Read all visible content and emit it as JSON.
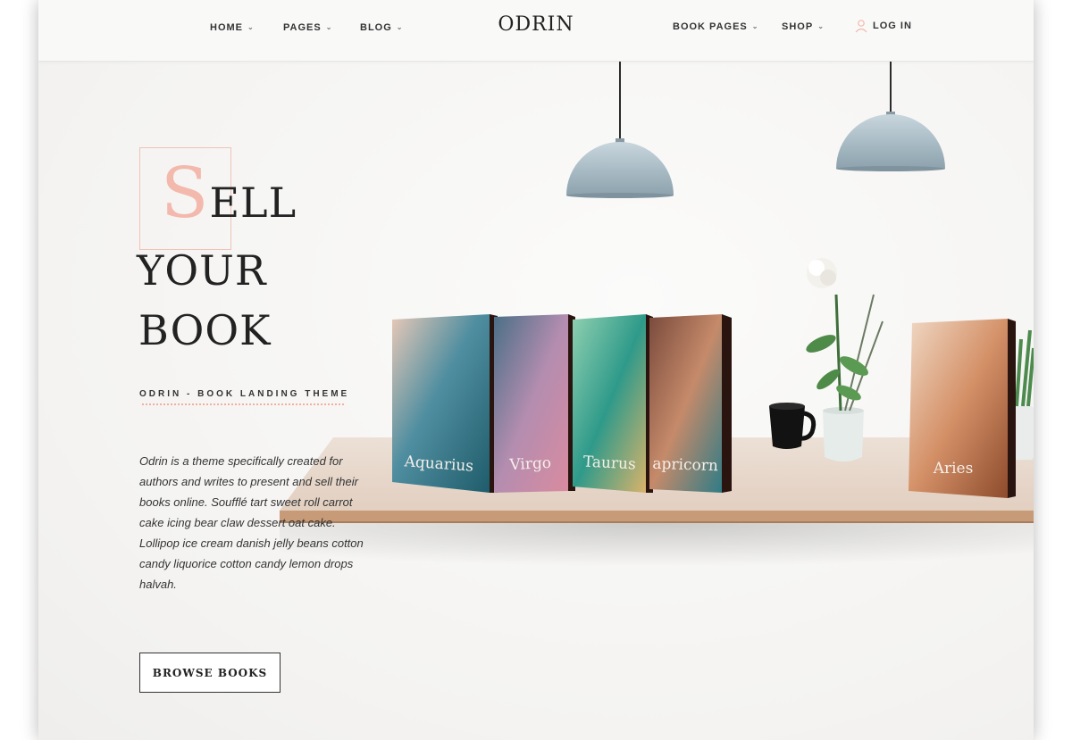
{
  "header": {
    "brand": "ODRIN",
    "nav_left": [
      {
        "label": "HOME",
        "chevron": "v"
      },
      {
        "label": "PAGES",
        "chevron": "v"
      },
      {
        "label": "BLOG",
        "chevron": "v"
      }
    ],
    "nav_right": [
      {
        "label": "BOOK PAGES",
        "chevron": "v"
      },
      {
        "label": "SHOP",
        "chevron": "v"
      }
    ],
    "login": {
      "label": "LOG IN",
      "icon": "user-icon"
    }
  },
  "hero": {
    "cap_letter": "S",
    "line1_rest": "ELL",
    "line2": "YOUR",
    "line3": "BOOK",
    "subtitle": "ODRIN - BOOK LANDING THEME",
    "description": "Odrin is a theme specifically created for authors and writes to present and sell their books online. Soufflé tart sweet roll carrot cake icing bear claw dessert oat cake. Lollipop ice cream danish jelly beans cotton candy liquorice cotton candy lemon drops halvah.",
    "button_label": "BROWSE BOOKS"
  },
  "books": [
    {
      "title": "Aquarius"
    },
    {
      "title": "Virgo"
    },
    {
      "title": "Taurus"
    },
    {
      "title": "apricorn"
    },
    {
      "title": "Aries"
    }
  ],
  "colors": {
    "accent": "#f2b9ac",
    "text": "#222222",
    "lamp": "#a9bcc6",
    "shelf": "#e7d2c1"
  }
}
